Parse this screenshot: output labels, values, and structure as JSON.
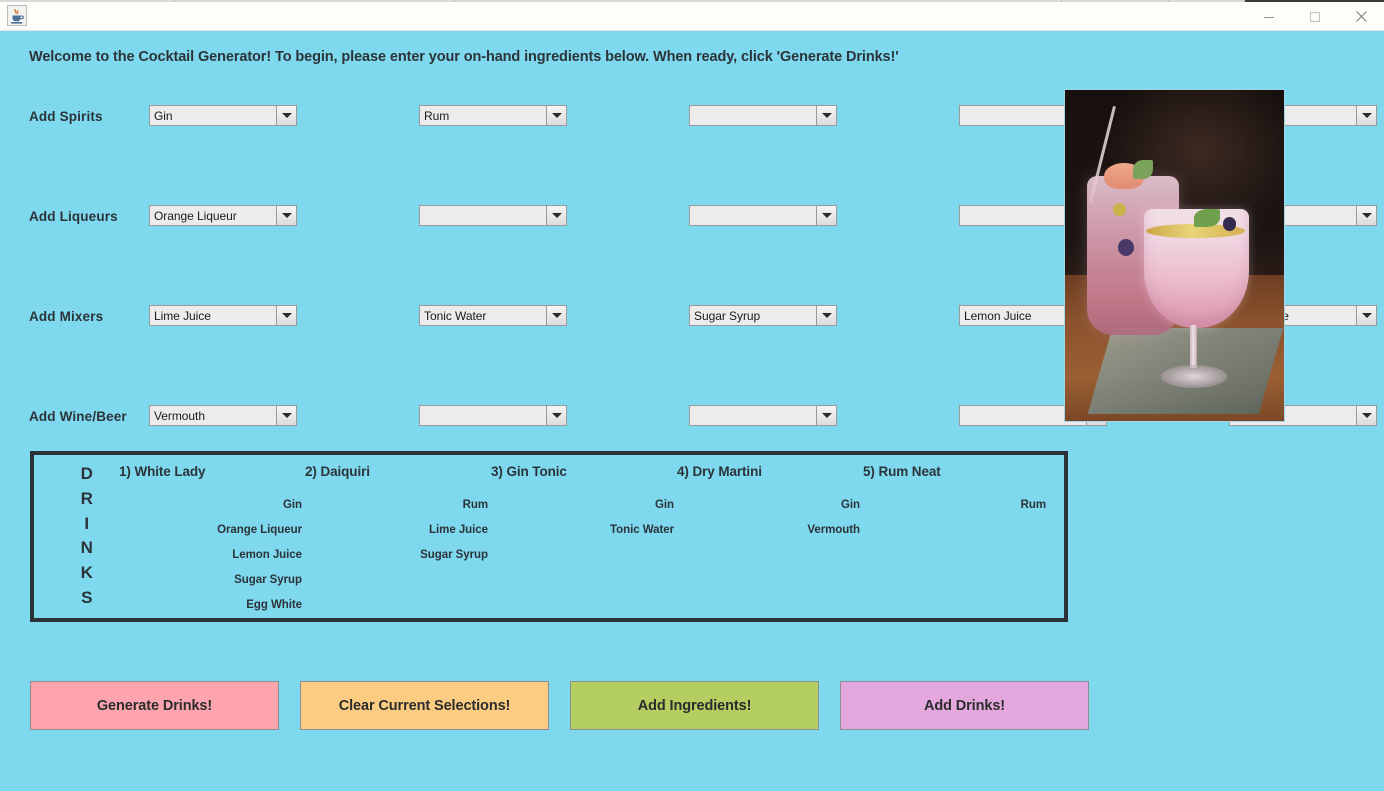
{
  "window": {
    "title": "",
    "app_icon": "java-coffee-cup-icon",
    "minimize_label": "–",
    "maximize_label": "□",
    "close_label": "✕"
  },
  "theme": {
    "background": "#7ed9ef",
    "text": "#2c3339",
    "panel_border": "#2a3238",
    "combo_fill": "#ececec",
    "combo_border": "#9a9a9a"
  },
  "welcome_message": "Welcome to the Cocktail Generator! To begin, please enter your on-hand ingredients below. When ready, click 'Generate Drinks!'",
  "ingredient_rows": [
    {
      "label": "Add Spirits",
      "name": "spirits",
      "selections": [
        "Gin",
        "Rum",
        "",
        "",
        ""
      ]
    },
    {
      "label": "Add Liqueurs",
      "name": "liqueurs",
      "selections": [
        "Orange Liqueur",
        "",
        "",
        "",
        ""
      ]
    },
    {
      "label": "Add Mixers",
      "name": "mixers",
      "selections": [
        "Lime Juice",
        "Tonic Water",
        "Sugar Syrup",
        "Lemon Juice",
        "Egg White"
      ]
    },
    {
      "label": "Add Wine/Beer",
      "name": "wine-beer",
      "selections": [
        "Vermouth",
        "",
        "",
        "",
        ""
      ]
    }
  ],
  "drinks_panel": {
    "vertical_label": "DRINKS",
    "vertical_label_letters": [
      "D",
      "R",
      "I",
      "N",
      "K",
      "S"
    ],
    "drinks": [
      {
        "title": "1) White Lady",
        "ingredients": [
          "Gin",
          "Orange Liqueur",
          "Lemon Juice",
          "Sugar Syrup",
          "Egg White"
        ]
      },
      {
        "title": "2) Daiquiri",
        "ingredients": [
          "Rum",
          "Lime Juice",
          "Sugar Syrup"
        ]
      },
      {
        "title": "3) Gin Tonic",
        "ingredients": [
          "Gin",
          "Tonic Water"
        ]
      },
      {
        "title": "4) Dry Martini",
        "ingredients": [
          "Gin",
          "Vermouth"
        ]
      },
      {
        "title": "5) Rum Neat",
        "ingredients": [
          "Rum"
        ]
      }
    ]
  },
  "buttons": [
    {
      "label": "Generate Drinks!",
      "name": "generate-drinks",
      "color": "#fda4ae"
    },
    {
      "label": "Clear Current Selections!",
      "name": "clear-selections",
      "color": "#fbcc82"
    },
    {
      "label": "Add Ingredients!",
      "name": "add-ingredients",
      "color": "#b5ce62"
    },
    {
      "label": "Add Drinks!",
      "name": "add-drinks",
      "color": "#e4a7de"
    }
  ],
  "photo": {
    "alt": "cocktail-photo",
    "description": "Two pink sparkling cocktails on a wooden table"
  }
}
